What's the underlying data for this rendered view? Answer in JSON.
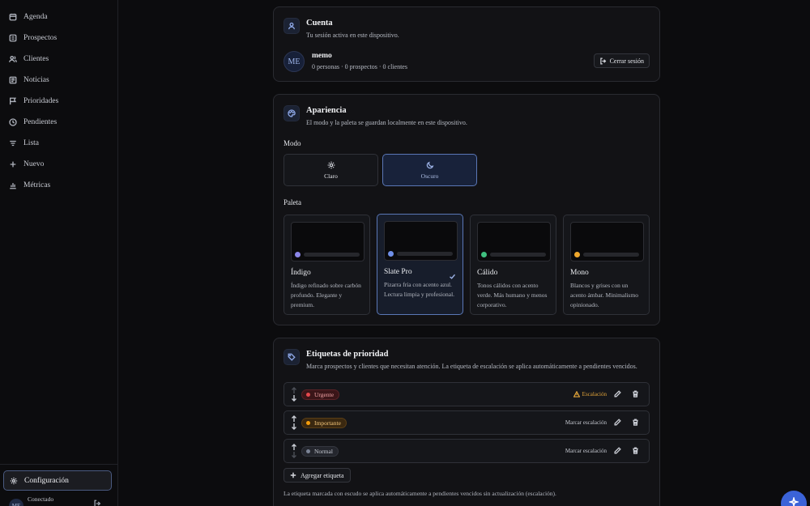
{
  "sidebar": {
    "items": [
      {
        "label": "Agenda",
        "icon": "calendar-icon"
      },
      {
        "label": "Prospectos",
        "icon": "contact-card-icon"
      },
      {
        "label": "Clientes",
        "icon": "users-icon"
      },
      {
        "label": "Noticias",
        "icon": "newspaper-icon"
      },
      {
        "label": "Prioridades",
        "icon": "flag-icon"
      },
      {
        "label": "Pendientes",
        "icon": "clock-icon"
      },
      {
        "label": "Lista",
        "icon": "list-filter-icon"
      },
      {
        "label": "Nuevo",
        "icon": "plus-icon"
      },
      {
        "label": "Métricas",
        "icon": "bar-chart-icon"
      }
    ],
    "config_label": "Configuración",
    "user": {
      "initials": "ME",
      "status": "Conectado"
    }
  },
  "account": {
    "title": "Cuenta",
    "subtitle": "Tu sesión activa en este dispositivo.",
    "initials": "ME",
    "name": "memo",
    "stats": "0 personas · 0 prospectos · 0 clientes",
    "logout_label": "Cerrar sesión"
  },
  "appearance": {
    "title": "Apariencia",
    "subtitle": "El modo y la paleta se guardan localmente en este dispositivo.",
    "mode_label": "Modo",
    "modes": [
      {
        "label": "Claro",
        "icon": "sun-icon",
        "selected": false
      },
      {
        "label": "Oscuro",
        "icon": "moon-icon",
        "selected": true
      }
    ],
    "palette_label": "Paleta",
    "palettes": [
      {
        "name": "Índigo",
        "desc": "Índigo refinado sobre carbón profundo. Elegante y premium.",
        "accent": "#8b86e8",
        "selected": false
      },
      {
        "name": "Slate Pro",
        "desc": "Pizarra fría con acento azul. Lectura limpia y profesional.",
        "accent": "#6f8fe8",
        "selected": true
      },
      {
        "name": "Cálido",
        "desc": "Tonos cálidos con acento verde. Más humano y menos corporativo.",
        "accent": "#3fbf7f",
        "selected": false
      },
      {
        "name": "Mono",
        "desc": "Blancos y grises con un acento ámbar. Minimalismo opinionado.",
        "accent": "#f0a82c",
        "selected": false
      }
    ]
  },
  "priority": {
    "title": "Etiquetas de prioridad",
    "subtitle": "Marca prospectos y clientes que necesitan atención. La etiqueta de escalación se aplica automáticamente a pendientes vencidos.",
    "tags": [
      {
        "label": "Urgente",
        "dot": "#e5484d",
        "bg": "#3a1518",
        "fg": "#f1a2a5",
        "action": "Escalación",
        "escalation": true
      },
      {
        "label": "Importante",
        "dot": "#f59e0b",
        "bg": "#3a2810",
        "fg": "#f5c77a",
        "action": "Marcar escalación",
        "escalation": false
      },
      {
        "label": "Normal",
        "dot": "#7b8496",
        "bg": "#24262d",
        "fg": "#c6cad3",
        "action": "Marcar escalación",
        "escalation": false
      }
    ],
    "add_label": "Agregar etiqueta",
    "footnote": "La etiqueta marcada con escudo se aplica automáticamente a pendientes vencidos sin actualización (escalación)."
  },
  "colors": {
    "accent": "#3b63d8",
    "warning": "#e3a53a"
  }
}
